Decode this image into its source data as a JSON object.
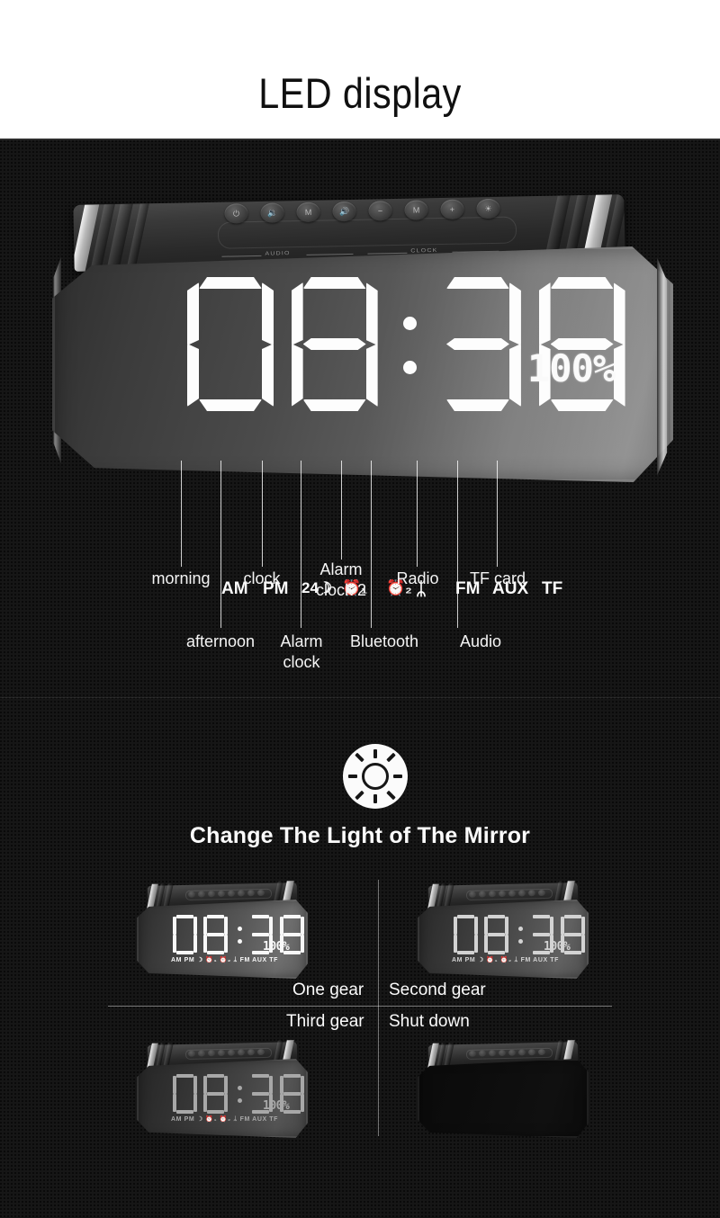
{
  "header": {
    "title": "LED display"
  },
  "display": {
    "time": "08:38",
    "hour_tens": "0",
    "hour_ones": "8",
    "min_tens": "3",
    "min_ones": "8",
    "battery": "100%",
    "indicators": [
      {
        "key": "am",
        "label": "AM"
      },
      {
        "key": "pm",
        "label": "PM"
      },
      {
        "key": "24h-moon",
        "label": "24☽"
      },
      {
        "key": "alarm-1",
        "label": "⏰₁"
      },
      {
        "key": "alarm-2",
        "label": "⏰₂"
      },
      {
        "key": "bluetooth",
        "label": "ᛦ"
      },
      {
        "key": "fm",
        "label": "FM"
      },
      {
        "key": "aux",
        "label": "AUX"
      },
      {
        "key": "tf",
        "label": "TF"
      }
    ]
  },
  "deck": {
    "audio_label": "AUDIO",
    "clock_label": "CLOCK",
    "buttons": [
      {
        "name": "power-button",
        "glyph": "⏻"
      },
      {
        "name": "volume-down-button",
        "glyph": "🔉"
      },
      {
        "name": "mode-button",
        "glyph": "M"
      },
      {
        "name": "volume-up-button",
        "glyph": "🔊"
      },
      {
        "name": "minus-button",
        "glyph": "−"
      },
      {
        "name": "memory-button",
        "glyph": "M"
      },
      {
        "name": "plus-button",
        "glyph": "+"
      },
      {
        "name": "brightness-button",
        "glyph": "☀"
      }
    ]
  },
  "callouts": [
    {
      "key": "morning",
      "label": "morning"
    },
    {
      "key": "afternoon",
      "label": "afternoon"
    },
    {
      "key": "clock",
      "label": "clock"
    },
    {
      "key": "alarm-clock",
      "label": "Alarm\nclock",
      "line1": "Alarm",
      "line2": "clock"
    },
    {
      "key": "alarm-clock-2",
      "label": "Alarm\nclock 2",
      "line1": "Alarm",
      "line2": "clock 2"
    },
    {
      "key": "bluetooth",
      "label": "Bluetooth"
    },
    {
      "key": "radio",
      "label": "Radio"
    },
    {
      "key": "audio",
      "label": "Audio"
    },
    {
      "key": "tf-card",
      "label": "TF card"
    }
  ],
  "brightness": {
    "icon": "sun-brightness-icon",
    "title": "Change The Light of The Mirror",
    "gears": [
      {
        "key": "one-gear",
        "label": "One gear"
      },
      {
        "key": "second-gear",
        "label": "Second gear"
      },
      {
        "key": "third-gear",
        "label": "Third gear"
      },
      {
        "key": "shut-down",
        "label": "Shut down"
      }
    ]
  },
  "mini_displays": {
    "time": "08:38",
    "battery": "100%",
    "indicator_strip": "AM  PM  ☽  ⏰₁ ⏰₂  ᛦ   FM  AUX  TF"
  },
  "colors": {
    "page_bg": "#ffffff",
    "dark_bg": "#161616",
    "led_white": "#fdfdfd",
    "text_light": "#f4f4f4",
    "title_dark": "#101010"
  }
}
